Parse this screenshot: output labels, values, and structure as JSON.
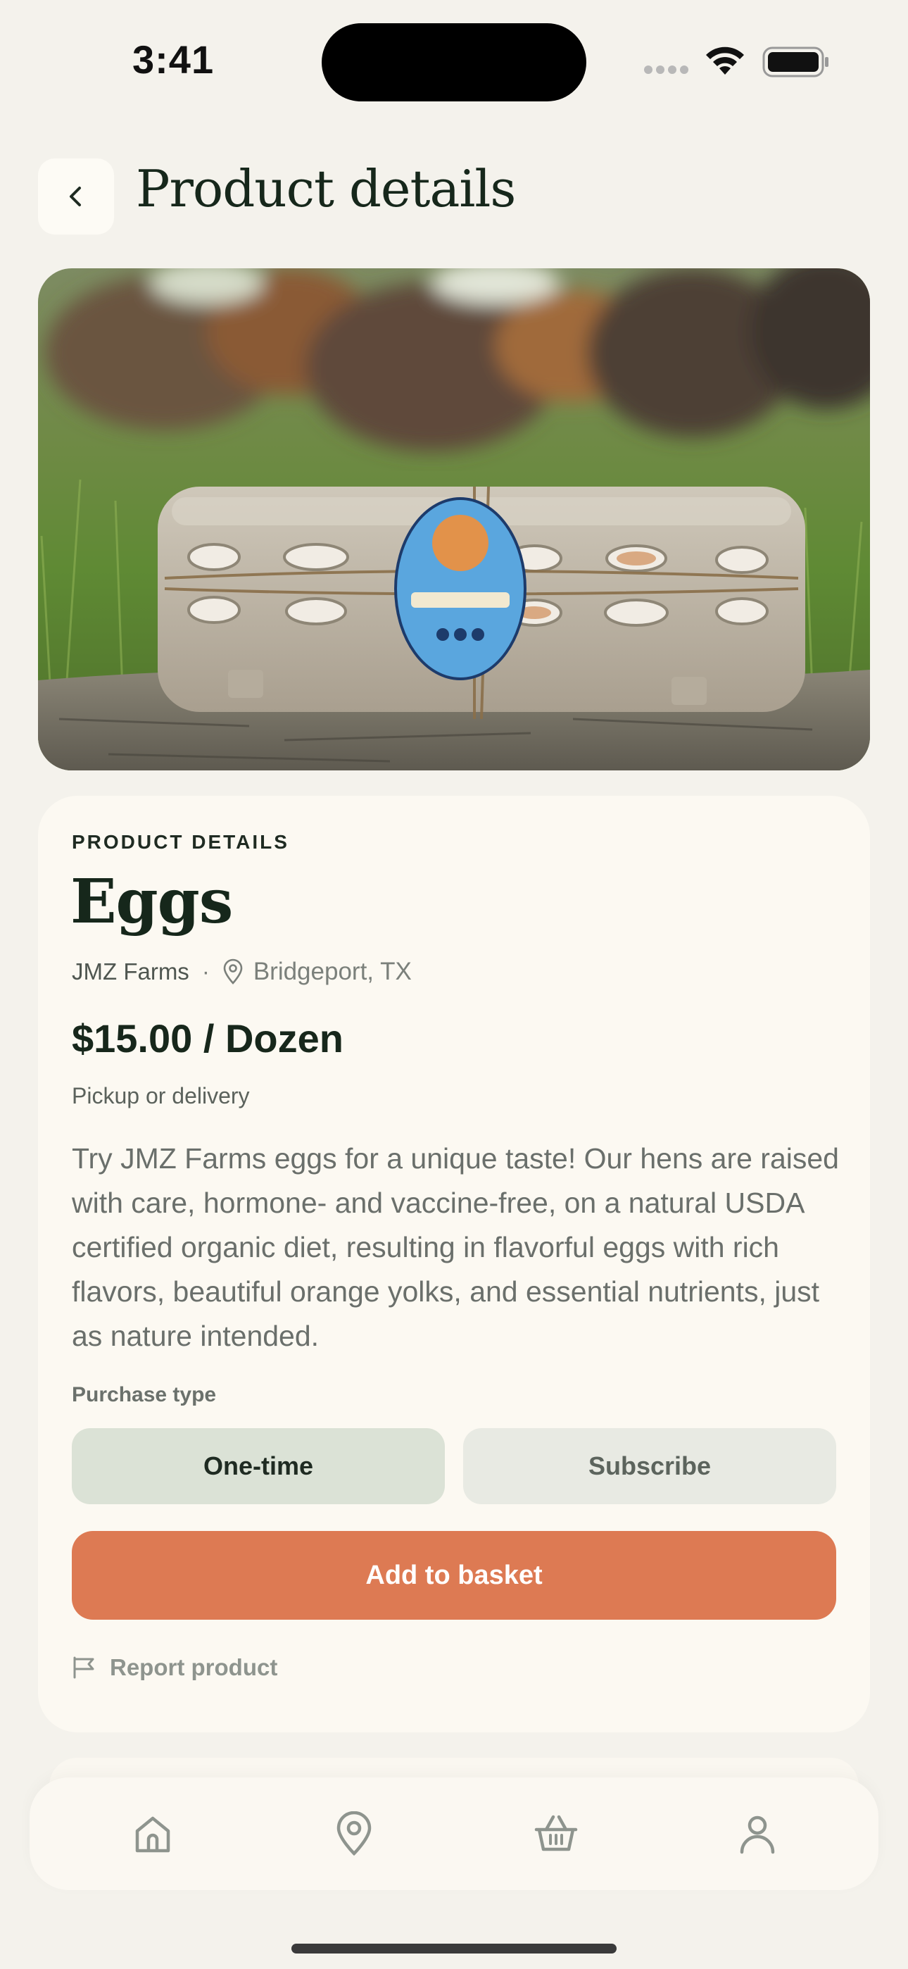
{
  "status_bar": {
    "time": "3:41"
  },
  "header": {
    "title": "Product details"
  },
  "product": {
    "photo_alt": "Egg carton tied with twine on a log with chickens in background",
    "section_label": "PRODUCT DETAILS",
    "name": "Eggs",
    "farm": "JMZ Farms",
    "separator": "·",
    "location": "Bridgeport, TX",
    "price": "$15.00 / Dozen",
    "fulfilment": "Pickup or delivery",
    "description": "Try JMZ Farms eggs for a unique taste! Our hens are raised with care, hormone- and vaccine-free, on a natural USDA certified organic diet, resulting in flavorful eggs with rich flavors, beautiful orange yolks, and essential nutrients, just as nature intended.",
    "purchase_type_label": "Purchase type",
    "options": [
      {
        "label": "One-time",
        "selected": true
      },
      {
        "label": "Subscribe",
        "selected": false
      }
    ],
    "add_to_basket": "Add to basket",
    "report": "Report product"
  },
  "nav": {
    "items": [
      {
        "icon": "home-icon"
      },
      {
        "icon": "map-pin-icon"
      },
      {
        "icon": "basket-icon"
      },
      {
        "icon": "user-icon"
      }
    ]
  },
  "colors": {
    "background": "#f4f2ec",
    "card": "#fcf9f2",
    "accent": "#dd7a53",
    "selected_option": "#dbe2d6",
    "unselected_option": "#e8eae3",
    "title_text": "#16271b"
  }
}
